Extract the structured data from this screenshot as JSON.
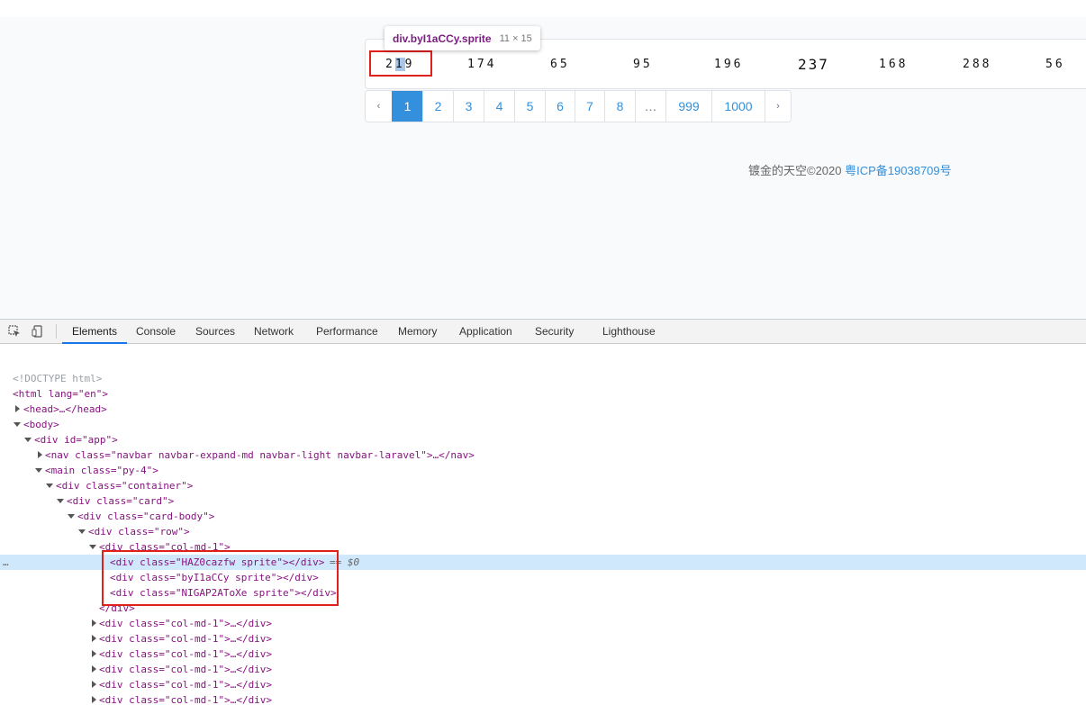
{
  "numbers": [
    "219",
    "174",
    "65",
    "95",
    "196",
    "237",
    "168",
    "288",
    "56"
  ],
  "tooltip": {
    "name": "div.byI1aCCy.sprite",
    "size": "11 × 15"
  },
  "pagination": [
    "‹",
    "1",
    "2",
    "3",
    "4",
    "5",
    "6",
    "7",
    "8",
    "…",
    "999",
    "1000",
    "›"
  ],
  "active_page": "1",
  "footer": {
    "text": "镀金的天空©2020 ",
    "link": "粤ICP备19038709号"
  },
  "devtools": {
    "tabs": [
      "Elements",
      "Console",
      "Sources",
      "Network",
      "Performance",
      "Memory",
      "Application",
      "Security",
      "Lighthouse"
    ],
    "active_tab": "Elements",
    "dom_lines": [
      "<!DOCTYPE html>",
      "<html lang=\"en\">",
      "<head>…</head>",
      "<body>",
      "<div id=\"app\">",
      "<nav class=\"navbar navbar-expand-md navbar-light navbar-laravel\">…</nav>",
      "<main class=\"py-4\">",
      "<div class=\"container\">",
      "<div class=\"card\">",
      "<div class=\"card-body\">",
      "<div class=\"row\">",
      "<div class=\"col-md-1\">",
      "<div class=\"HAZ0cazfw sprite\"></div>",
      "<div class=\"byI1aCCy sprite\"></div>",
      "<div class=\"NIGAP2AToXe sprite\"></div>",
      "</div>",
      "<div class=\"col-md-1\">…</div>"
    ],
    "selected_suffix": "== $0",
    "more_icon": "…"
  },
  "icons": [
    "inspect-icon",
    "device-toolbar-icon"
  ]
}
